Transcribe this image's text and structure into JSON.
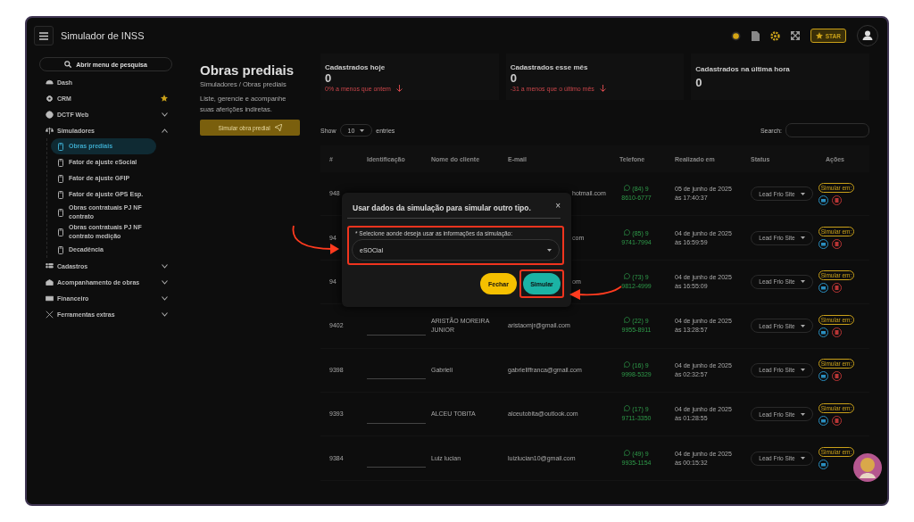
{
  "app": {
    "title": "Simulador de INSS",
    "star_label": "STAR"
  },
  "sidebar": {
    "search": "Abrir menu de pesquisa",
    "items": [
      {
        "label": "Dash",
        "kind": "link",
        "starred": false
      },
      {
        "label": "CRM",
        "kind": "link",
        "starred": true
      },
      {
        "label": "DCTF Web",
        "kind": "group",
        "expanded": false
      },
      {
        "label": "Simuladores",
        "kind": "group",
        "expanded": true,
        "children": [
          {
            "label": "Obras prediais",
            "selected": true
          },
          {
            "label": "Fator de ajuste eSocial",
            "selected": false
          },
          {
            "label": "Fator de ajuste GFIP",
            "selected": false
          },
          {
            "label": "Fator de ajuste GPS Esp.",
            "selected": false
          },
          {
            "label": "Obras contratuais PJ NF contrato",
            "selected": false
          },
          {
            "label": "Obras contratuais PJ NF contrato medição",
            "selected": false
          },
          {
            "label": "Decadência",
            "selected": false
          }
        ]
      },
      {
        "label": "Cadastros",
        "kind": "group",
        "expanded": false
      },
      {
        "label": "Acompanhamento de obras",
        "kind": "group",
        "expanded": false
      },
      {
        "label": "Financeiro",
        "kind": "group",
        "expanded": false
      },
      {
        "label": "Ferramentas extras",
        "kind": "group",
        "expanded": false
      }
    ]
  },
  "page": {
    "title": "Obras prediais",
    "breadcrumb": "Simuladores / Obras prediais",
    "description": "Liste, gerencie e acompanhe suas aferições indiretas.",
    "button": "Simular obra predial"
  },
  "stats": [
    {
      "label": "Cadastrados hoje",
      "value": "0",
      "change": "0% a menos que ontem"
    },
    {
      "label": "Cadastrados esse mês",
      "value": "0",
      "change": "-31 a menos que o último mês"
    },
    {
      "label": "Cadastrados na última hora",
      "value": "0"
    }
  ],
  "table": {
    "show_label": "Show",
    "page_size": "10",
    "entries_label": "entries",
    "search_label": "Search:",
    "columns": [
      "#",
      "Identificação",
      "Nome do cliente",
      "E-mail",
      "Telefone",
      "Realizado em",
      "Status",
      "Ações"
    ],
    "rows": [
      {
        "id": "948",
        "email": "hotmail.com",
        "phone": "(84) 9 8610-6777",
        "date": "05 de junho de 2025 às 17:40:37",
        "status": "Lead Frio Site",
        "action": "Simular em:"
      },
      {
        "id": "94",
        "email": "com",
        "phone": "(85) 9 9741-7994",
        "date": "04 de junho de 2025 às 16:59:59",
        "status": "Lead Frio Site",
        "action": "Simular em:"
      },
      {
        "id": "94",
        "email": "om",
        "phone": "(73) 9 9812-4999",
        "date": "04 de junho de 2025 às 16:55:09",
        "status": "Lead Frio Site",
        "action": "Simular em:"
      },
      {
        "id": "9402",
        "name": "ARISTÃO MOREIRA JUNIOR",
        "email": "aristaomjr@gmail.com",
        "phone": "(22) 9 9955-8911",
        "date": "04 de junho de 2025 às 13:28:57",
        "status": "Lead Frio Site",
        "action": "Simular em:"
      },
      {
        "id": "9398",
        "name": "Gabrieli",
        "email": "gabrieliffranca@gmail.com",
        "phone": "(16) 9 9998-5329",
        "date": "04 de junho de 2025 às 02:32:57",
        "status": "Lead Frio Site",
        "action": "Simular em:"
      },
      {
        "id": "9393",
        "name": "ALCEU TOBITA",
        "email": "alceutobita@outlook.com",
        "phone": "(17) 9 9711-3350",
        "date": "04 de junho de 2025 às 01:28:55",
        "status": "Lead Frio Site",
        "action": "Simular em:"
      },
      {
        "id": "9384",
        "name": "Luiz lucian",
        "email": "luizlucian10@gmail.com",
        "phone": "(49) 9 9935-1154",
        "date": "04 de junho de 2025 às 00:15:32",
        "status": "Lead Frio Site",
        "action": "Simular em:"
      }
    ]
  },
  "modal": {
    "title": "Usar dados da simulação para simular outro tipo.",
    "close": "×",
    "field_label": "* Selecione aonde deseja usar as informações da simulação:",
    "value": "eSOCial",
    "buttons": [
      {
        "label": "Fechar",
        "kind": "secondary"
      },
      {
        "label": "Simular",
        "kind": "primary"
      }
    ]
  }
}
